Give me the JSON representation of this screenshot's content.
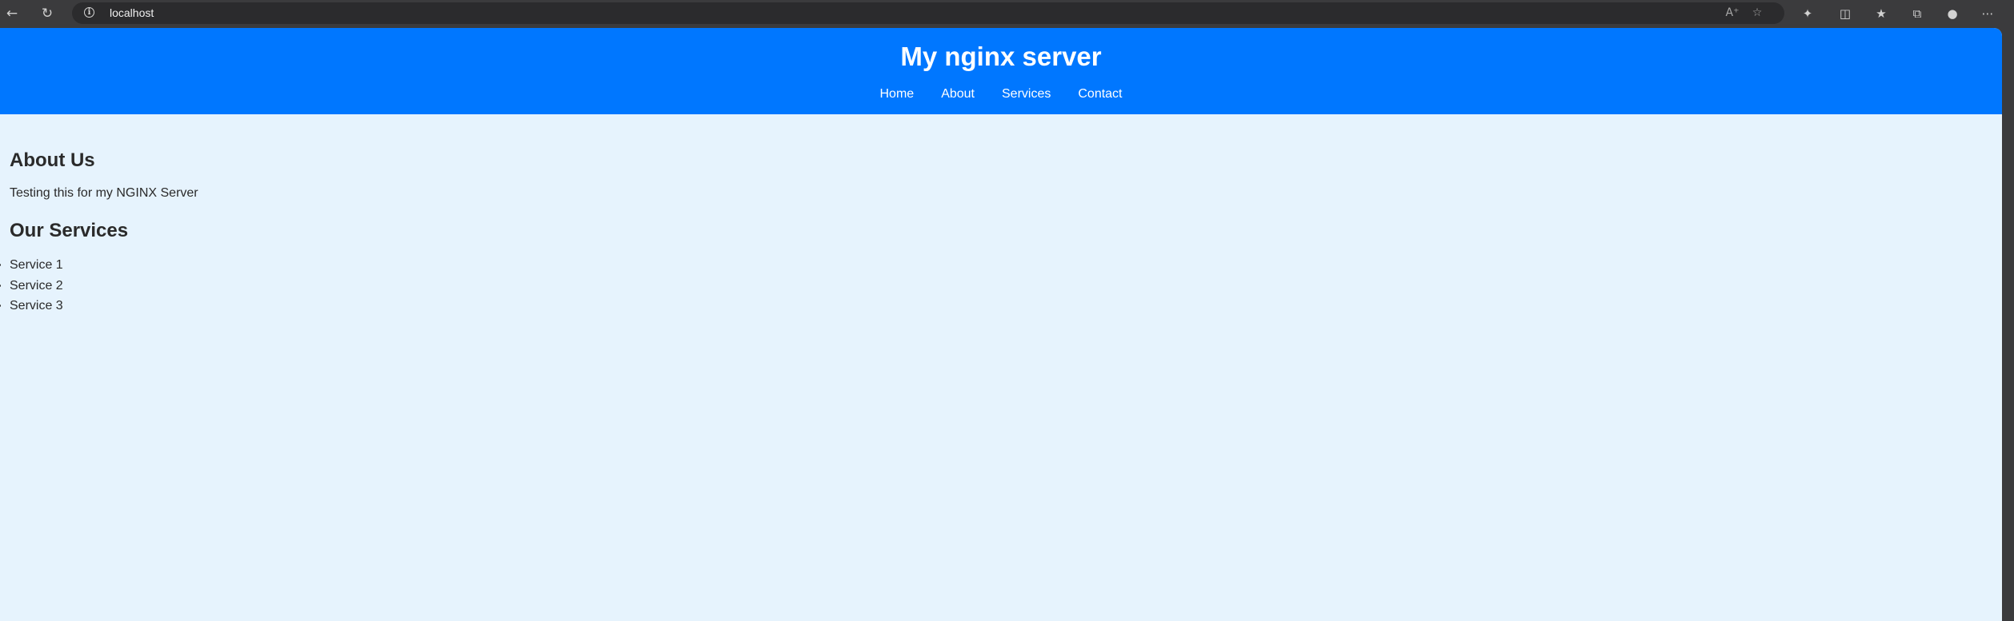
{
  "browser": {
    "url": "localhost",
    "icons": {
      "back": "arrow-left-icon",
      "refresh": "refresh-icon",
      "info": "info-icon",
      "read_aloud": "read-aloud-icon",
      "favorite": "star-icon",
      "extensions": "puzzle-icon",
      "split_screen": "split-screen-icon",
      "favorites_list": "favorites-icon",
      "collections": "collections-icon",
      "profile": "profile-icon",
      "more": "more-icon"
    }
  },
  "header": {
    "title": "My nginx server",
    "nav": [
      "Home",
      "About",
      "Services",
      "Contact"
    ],
    "background_color": "#0077ff"
  },
  "about": {
    "heading": "About Us",
    "text": "Testing this for my NGINX Server"
  },
  "services": {
    "heading": "Our Services",
    "items": [
      "Service 1",
      "Service 2",
      "Service 3"
    ]
  },
  "page": {
    "background_color": "#e6f3fd"
  }
}
